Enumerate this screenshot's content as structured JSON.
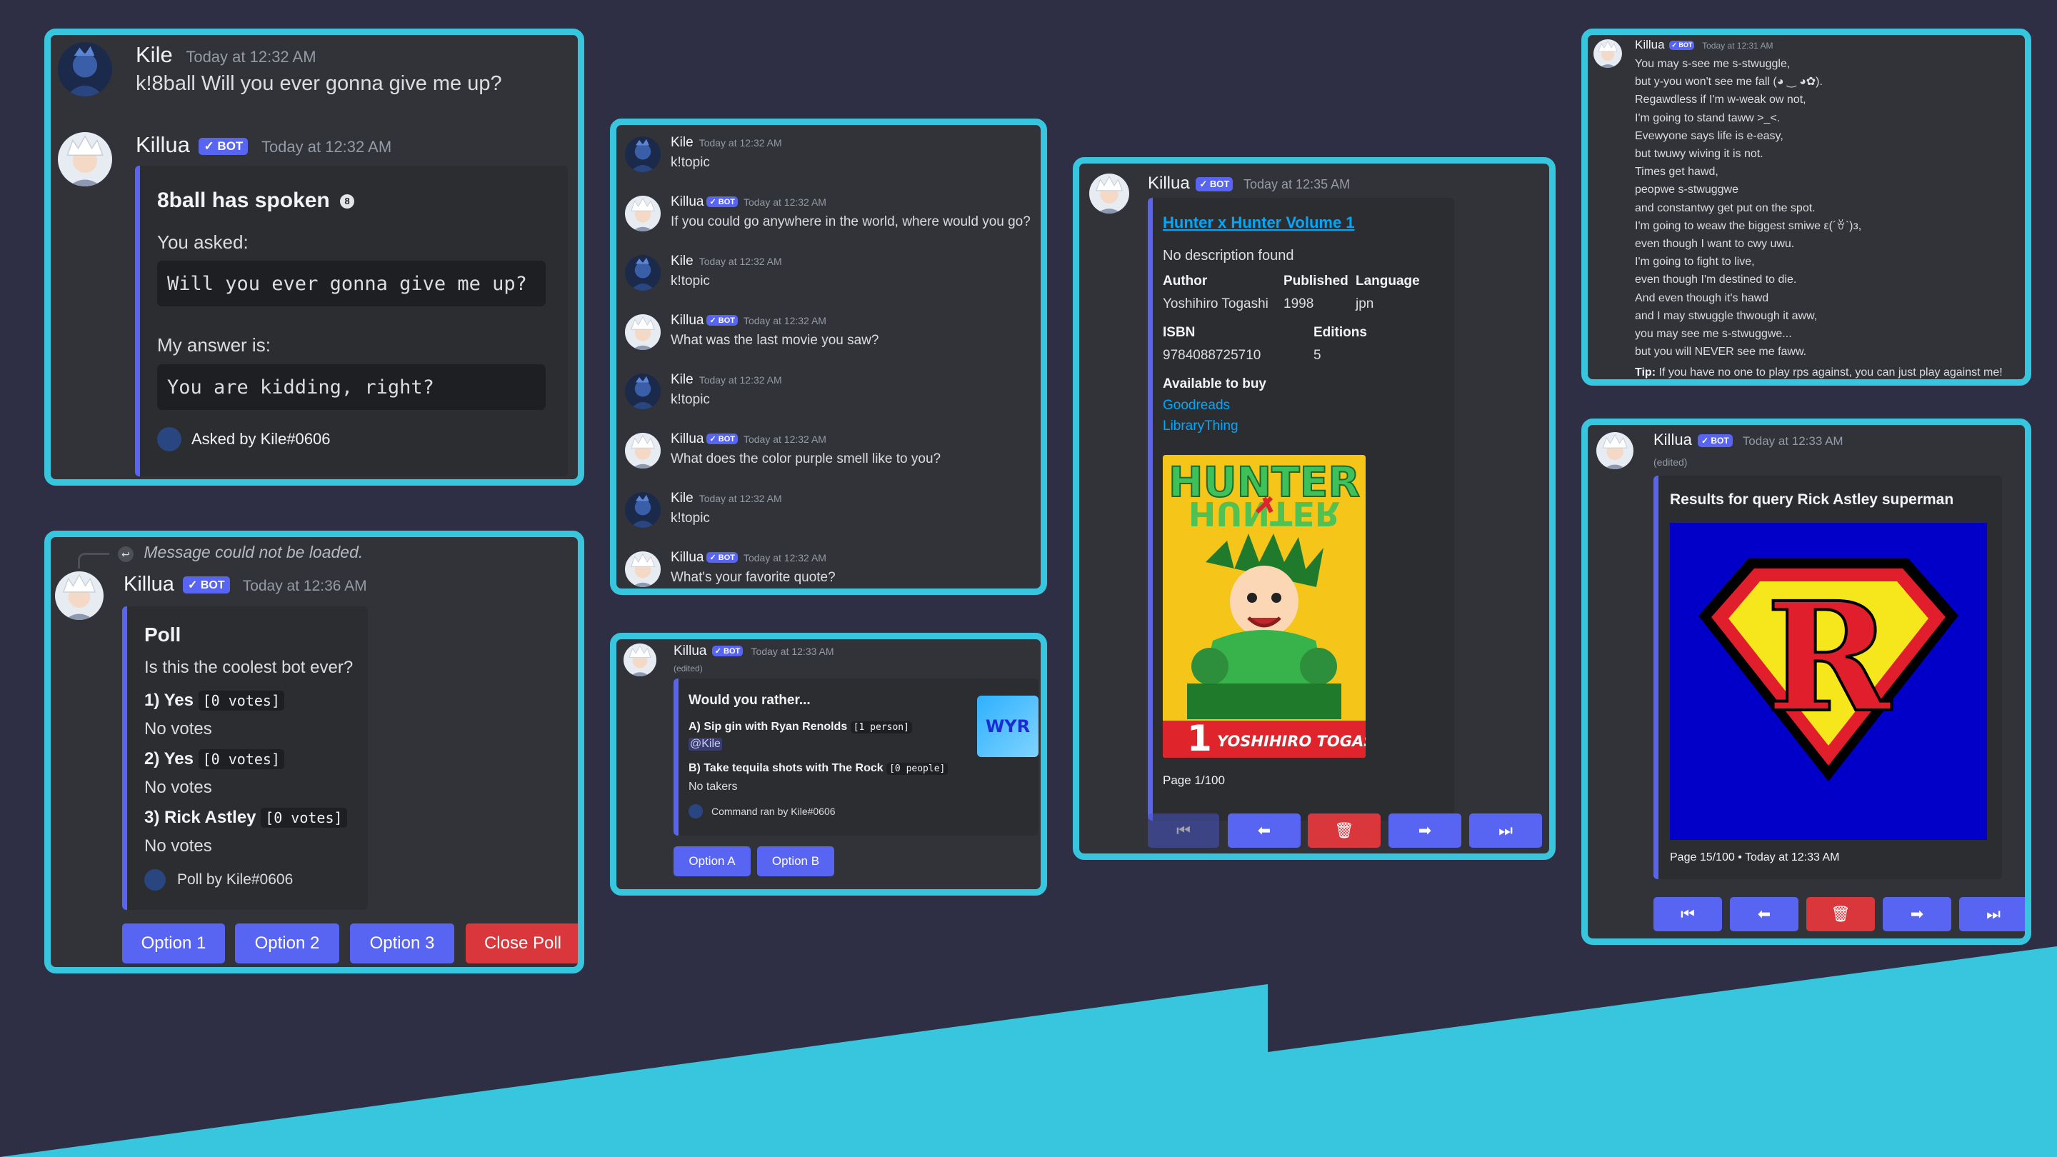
{
  "panel1": {
    "m1_user": "Kile",
    "m1_time": "Today at 12:32 AM",
    "m1_text": "k!8ball Will you ever gonna give me up?",
    "m2_user": "Killua",
    "bot_label": "✓ BOT",
    "m2_time": "Today at 12:32 AM",
    "embed_title": "8ball has spoken",
    "asked_label": "You asked:",
    "question": "Will you ever gonna give me up?",
    "answer_label": "My answer is:",
    "answer": "You are kidding, right?",
    "footer": "Asked by Kile#0606"
  },
  "panel2": {
    "reply_text": "Message could not be loaded.",
    "user": "Killua",
    "bot_label": "✓ BOT",
    "time": "Today at 12:36 AM",
    "title": "Poll",
    "question": "Is this the coolest bot ever?",
    "options": [
      {
        "label": "1) Yes",
        "votes": "[0 votes]",
        "sub": "No votes"
      },
      {
        "label": "2) Yes",
        "votes": "[0 votes]",
        "sub": "No votes"
      },
      {
        "label": "3) Rick Astley",
        "votes": "[0 votes]",
        "sub": "No votes"
      }
    ],
    "footer": "Poll by Kile#0606",
    "buttons": [
      "Option 1",
      "Option 2",
      "Option 3",
      "Close Poll"
    ]
  },
  "panel3": {
    "messages": [
      {
        "user": "Kile",
        "time": "Today at 12:32 AM",
        "text": "k!topic",
        "bot": false
      },
      {
        "user": "Killua",
        "time": "Today at 12:32 AM",
        "text": "If you could go anywhere in the world, where would you go?",
        "bot": true
      },
      {
        "user": "Kile",
        "time": "Today at 12:32 AM",
        "text": "k!topic",
        "bot": false
      },
      {
        "user": "Killua",
        "time": "Today at 12:32 AM",
        "text": "What was the last movie you saw?",
        "bot": true
      },
      {
        "user": "Kile",
        "time": "Today at 12:32 AM",
        "text": "k!topic",
        "bot": false
      },
      {
        "user": "Killua",
        "time": "Today at 12:32 AM",
        "text": "What does the color purple smell like to you?",
        "bot": true
      },
      {
        "user": "Kile",
        "time": "Today at 12:32 AM",
        "text": "k!topic",
        "bot": false
      },
      {
        "user": "Killua",
        "time": "Today at 12:32 AM",
        "text": "What's your favorite quote?",
        "bot": true
      }
    ],
    "bot_label": "✓ BOT"
  },
  "panel4": {
    "user": "Killua",
    "bot_label": "✓ BOT",
    "time": "Today at 12:33 AM",
    "edited": "(edited)",
    "title": "Would you rather...",
    "opt_a": "A) Sip gin with Ryan Renolds",
    "opt_a_count": "[1 person]",
    "opt_a_voter": "@Kile",
    "opt_b": "B) Take tequila shots with The Rock",
    "opt_b_count": "[0 people]",
    "opt_b_voter": "No takers",
    "footer": "Command ran by Kile#0606",
    "thumb_text": "WYR",
    "buttons": [
      "Option A",
      "Option B"
    ]
  },
  "panel5": {
    "user": "Killua",
    "bot_label": "✓ BOT",
    "time": "Today at 12:35 AM",
    "title": "Hunter x Hunter Volume 1",
    "desc": "No description found",
    "author_label": "Author",
    "author": "Yoshihiro Togashi",
    "published_label": "Published",
    "published": "1998",
    "language_label": "Language",
    "language": "jpn",
    "isbn_label": "ISBN",
    "isbn": "9784088725710",
    "editions_label": "Editions",
    "editions": "5",
    "buy_label": "Available to buy",
    "buy_links": [
      "Goodreads",
      "LibraryThing"
    ],
    "cover_title": "HUNTER",
    "cover_number": "1",
    "cover_author": "YOSHIHIRO TOGASHI",
    "footer": "Page 1/100"
  },
  "panel6": {
    "user": "Killua",
    "bot_label": "✓ BOT",
    "time": "Today at 12:31 AM",
    "lines": [
      "You may s-see me s-stwuggle,",
      "but y-you won't see me fall (◕ ‿ ◕✿).",
      "Regawdless if I'm w-weak ow not,",
      "I'm going to stand taww >_<.",
      "Evewyone says life is e-easy,",
      "but twuwy wiving it is not.",
      "Times get hawd,",
      "peopwe s-stwuggwe",
      "and constantwy get put on the spot.",
      "I'm going to weaw the biggest smiwe ε(´ꈊ`)з,",
      "even though I want to cwy uwu.",
      "I'm going to fight to live,",
      "even though I'm destined to die.",
      "And even though it's hawd",
      "and I may stwuggle thwough it aww,",
      "you may see me s-stwuggwe...",
      "but you will NEVER see me faww."
    ],
    "tip_label": "Tip:",
    "tip": "If you have no one to play rps against, you can just play against me!"
  },
  "panel7": {
    "user": "Killua",
    "bot_label": "✓ BOT",
    "time": "Today at 12:33 AM",
    "edited": "(edited)",
    "title": "Results for query Rick Astley superman",
    "emblem_letter": "R",
    "footer": "Page 15/100 • Today at 12:33 AM"
  },
  "icons": {
    "first": "⏮",
    "prev": "⬅",
    "delete": "🗑",
    "next": "➡",
    "last": "⏭"
  }
}
